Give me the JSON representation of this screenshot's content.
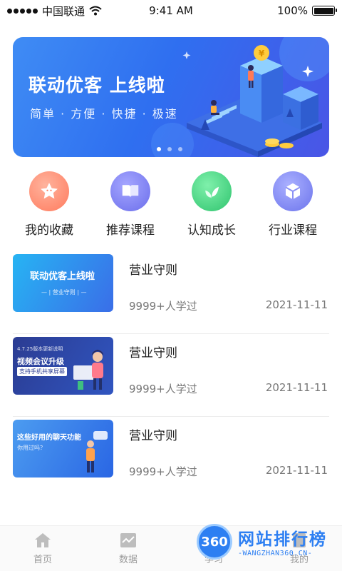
{
  "status_bar": {
    "carrier": "中国联通",
    "time": "9:41 AM",
    "battery": "100%"
  },
  "banner": {
    "title": "联动优客 上线啦",
    "subtitle": "简单 · 方便 · 快捷 · 极速",
    "page_count": 3,
    "active_page": 1
  },
  "quick_nav": [
    {
      "label": "我的收藏",
      "icon": "star-icon",
      "color": "#ff8b6e"
    },
    {
      "label": "推荐课程",
      "icon": "book-icon",
      "color": "#7a7cf0"
    },
    {
      "label": "认知成长",
      "icon": "leaf-icon",
      "color": "#3fd07e"
    },
    {
      "label": "行业课程",
      "icon": "cube-icon",
      "color": "#7e86f2"
    }
  ],
  "courses": [
    {
      "title": "营业守则",
      "count": "9999+人学过",
      "date": "2021-11-11",
      "thumb": {
        "line1": "联动优客上线啦",
        "line2": "— | 营业守则 | —"
      }
    },
    {
      "title": "营业守则",
      "count": "9999+人学过",
      "date": "2021-11-11",
      "thumb": {
        "line0": "4.7.25版本更新说明",
        "line1": "视频会议升级",
        "line2": "支持手机共享屏幕"
      }
    },
    {
      "title": "营业守则",
      "count": "9999+人学过",
      "date": "2021-11-11",
      "thumb": {
        "line1": "这些好用的聊天功能",
        "line2": "你用过吗？"
      }
    }
  ],
  "tab_bar": {
    "tabs": [
      {
        "label": "首页",
        "icon": "home-icon"
      },
      {
        "label": "数据",
        "icon": "chart-icon"
      },
      {
        "label": "学习",
        "icon": "learn-icon"
      },
      {
        "label": "我的",
        "icon": "profile-icon"
      }
    ]
  },
  "watermark": {
    "logo": "360",
    "text": "网站排行榜",
    "sub": "-WANGZHAN360.CN-"
  },
  "colors": {
    "primary": "#2d7ff2",
    "banner_start": "#3f8cf4",
    "banner_end": "#4a55e6"
  }
}
